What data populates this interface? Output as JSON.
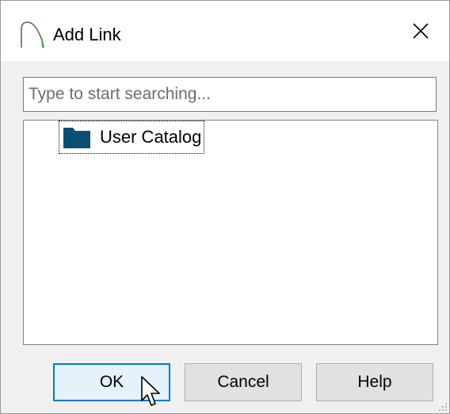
{
  "window": {
    "title": "Add Link"
  },
  "search": {
    "placeholder": "Type to start searching...",
    "value": ""
  },
  "tree": {
    "items": [
      {
        "label": "User Catalog",
        "icon": "folder-icon",
        "selected": true
      }
    ]
  },
  "buttons": {
    "ok_label": "OK",
    "cancel_label": "Cancel",
    "help_label": "Help"
  },
  "colors": {
    "folder": "#0d4f73",
    "accent": "#0078d7",
    "app_icon": "#7a6a4a"
  }
}
